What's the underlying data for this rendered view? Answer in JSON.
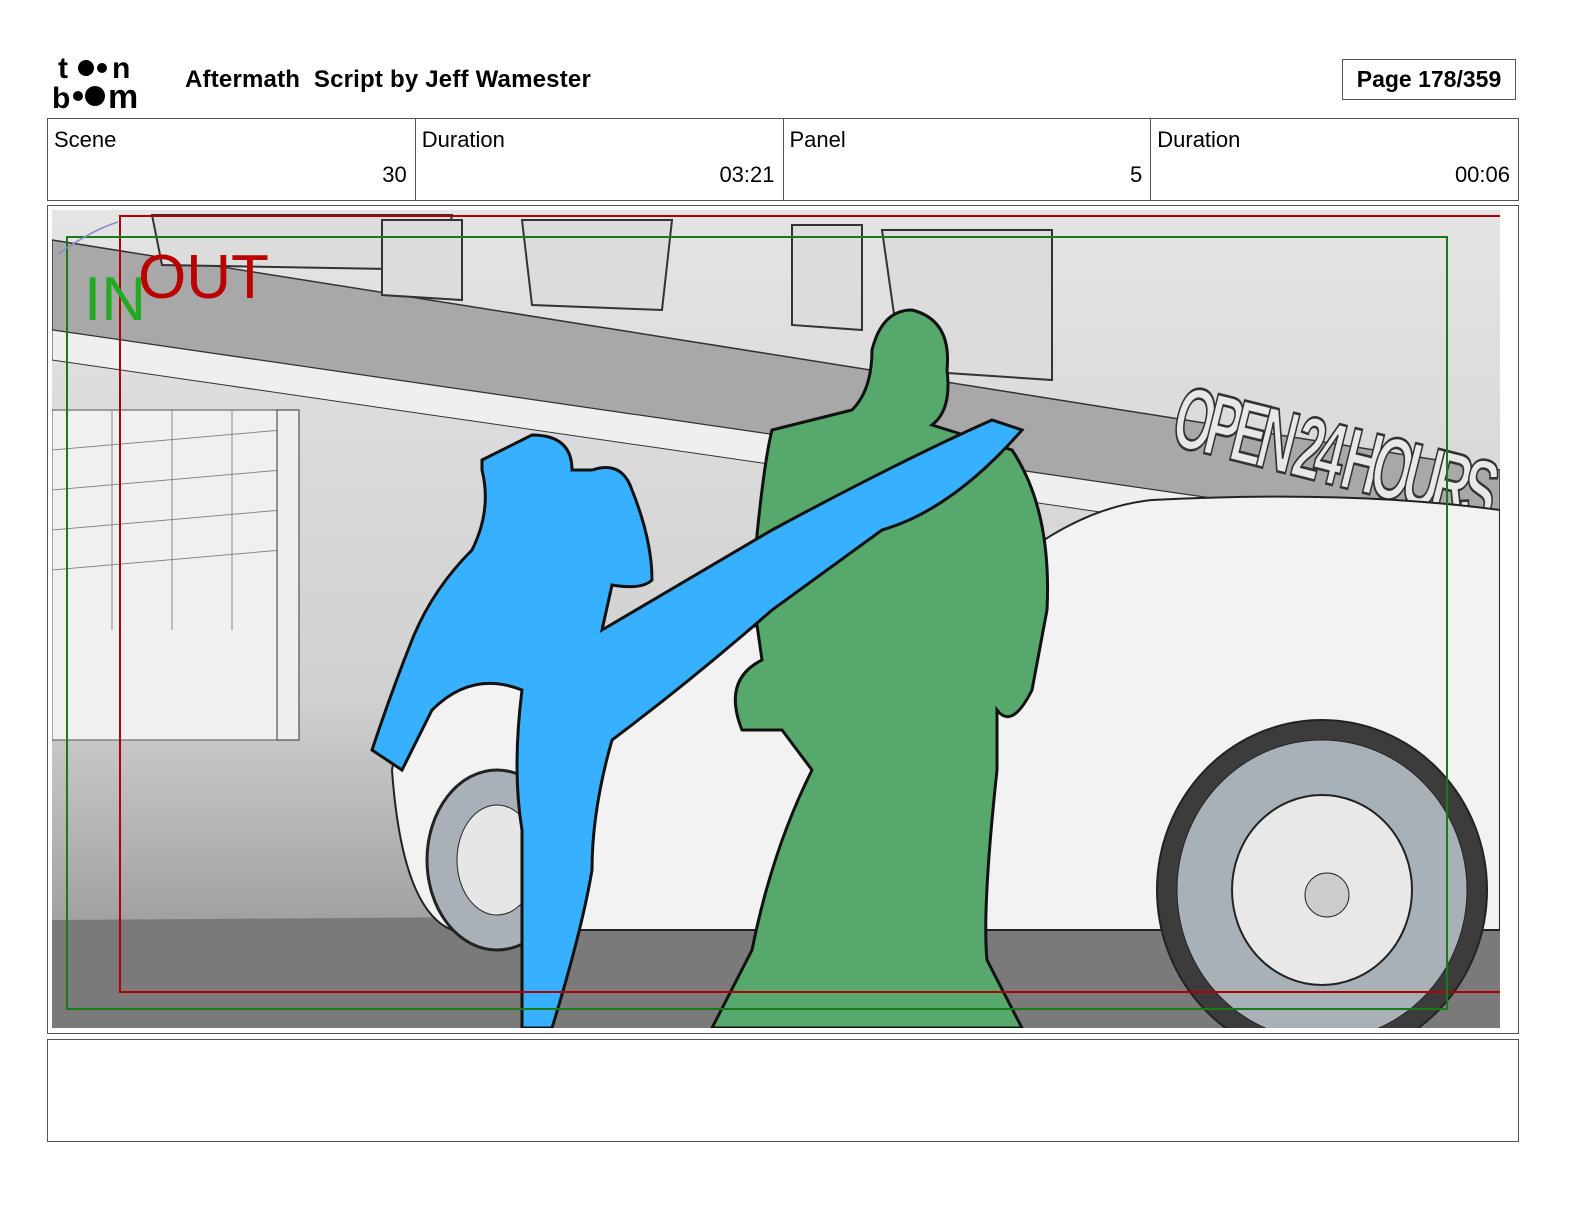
{
  "header": {
    "logo_text": "toon boom",
    "title": "Aftermath  Script by Jeff Wamester",
    "page": "Page 178/359"
  },
  "info": {
    "scene_label": "Scene",
    "scene_value": "30",
    "scene_duration_label": "Duration",
    "scene_duration_value": "03:21",
    "panel_label": "Panel",
    "panel_value": "5",
    "panel_duration_label": "Duration",
    "panel_duration_value": "00:06"
  },
  "panel_image": {
    "in_label": "IN",
    "out_label": "OUT",
    "sign_text": "OPEN 24 HOURS",
    "in_color": "#22aa22",
    "out_color": "#bb0000"
  },
  "caption": {
    "text": ""
  }
}
